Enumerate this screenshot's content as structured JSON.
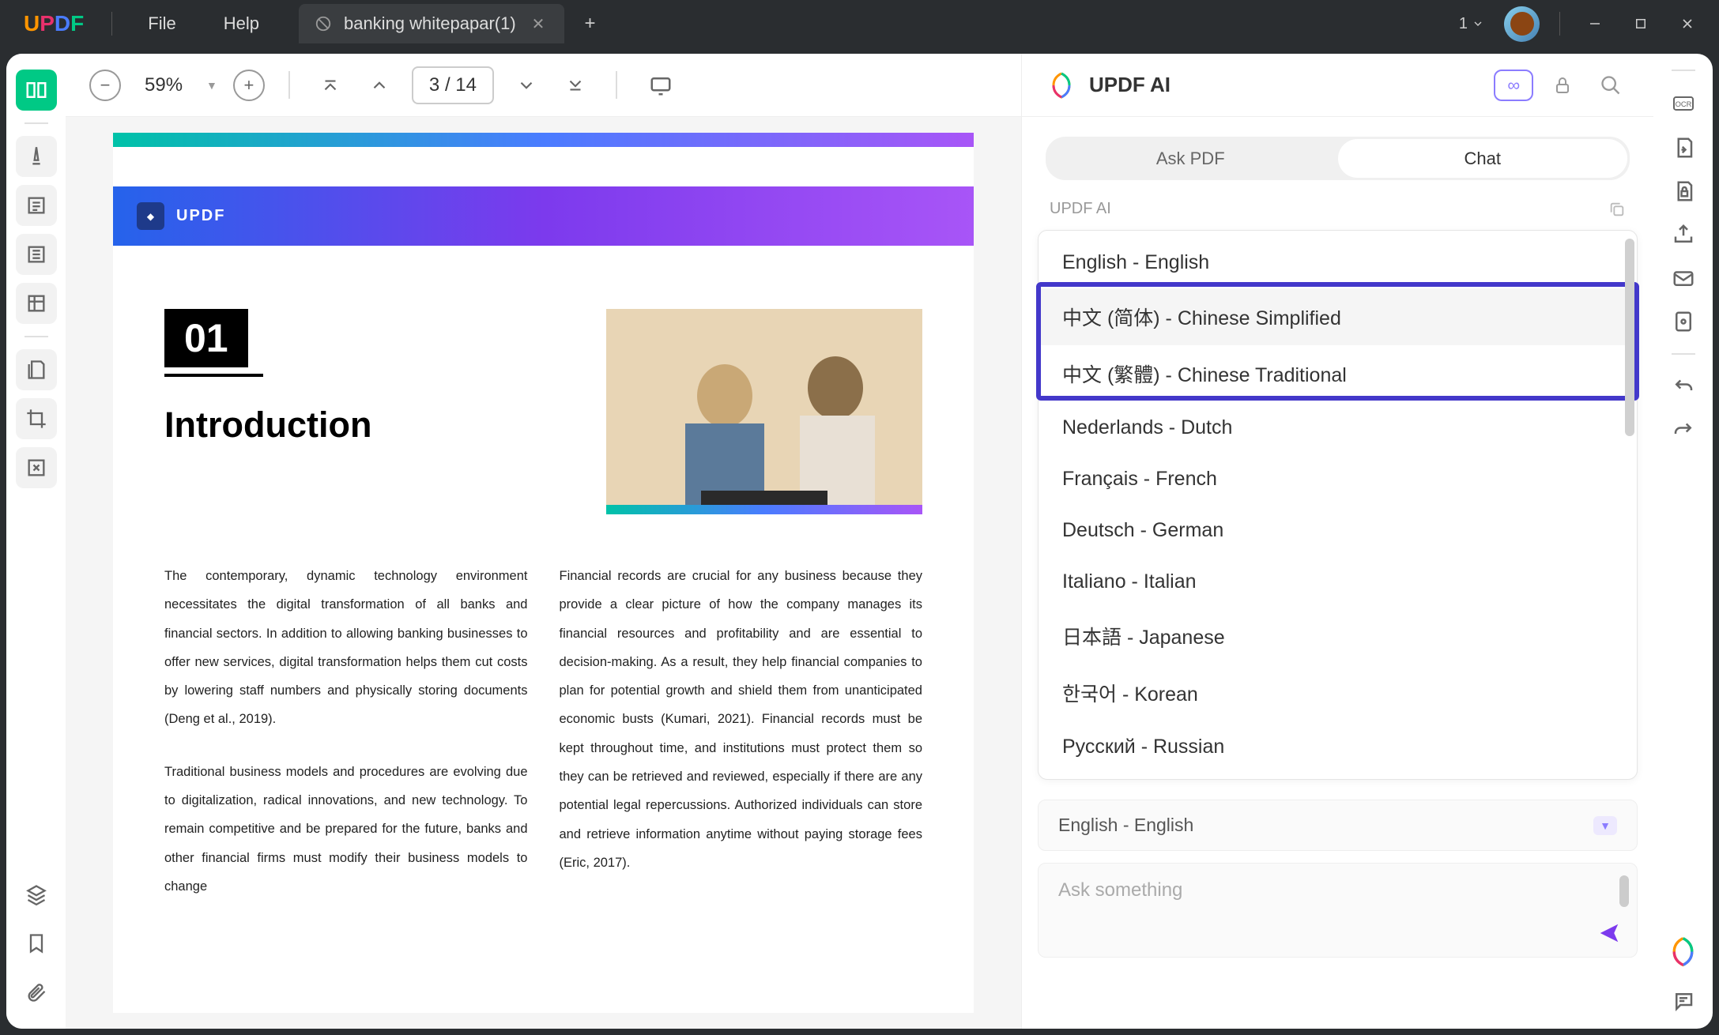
{
  "titlebar": {
    "logo": {
      "u": "U",
      "p": "P",
      "d": "D",
      "f": "F"
    },
    "menu": {
      "file": "File",
      "help": "Help"
    },
    "tab": {
      "title": "banking whitepapar(1)"
    },
    "window_count": "1"
  },
  "toolbar": {
    "zoom": "59%",
    "page_current": "3",
    "page_sep": "/",
    "page_total": "14"
  },
  "document": {
    "header_brand": "UPDF",
    "section_num": "01",
    "section_title": "Introduction",
    "col1_p1": "The contemporary, dynamic technology environment necessitates the digital transformation of all banks and financial sectors. In addition to allowing banking businesses to offer new services, digital transformation helps them cut costs by lowering staff numbers and physically storing documents (Deng et al., 2019).",
    "col1_p2": "Traditional business models and procedures are evolving due to digitalization, radical innovations, and new technology. To remain competitive and be prepared for the future, banks and other financial firms must modify their business models to change",
    "col2_p1": "Financial records are crucial for any business because they provide a clear picture of how the company manages its financial resources and profitability and are essential to decision-making. As a result, they help financial companies to plan for potential growth and shield them from unanticipated economic busts (Kumari, 2021). Financial records must be kept throughout time, and institutions must protect them so they can be retrieved and reviewed, especially if there are any potential legal repercussions. Authorized individuals can store and retrieve information anytime without paying storage fees (Eric, 2017)."
  },
  "ai": {
    "title": "UPDF AI",
    "tabs": {
      "ask": "Ask PDF",
      "chat": "Chat"
    },
    "label": "UPDF AI",
    "languages": [
      "English - English",
      "中文 (简体) - Chinese Simplified",
      "中文 (繁體) - Chinese Traditional",
      "Nederlands - Dutch",
      "Français - French",
      "Deutsch - German",
      "Italiano - Italian",
      "日本語 - Japanese",
      "한국어 - Korean",
      "Русский - Russian"
    ],
    "selected_language": "English - English",
    "ask_placeholder": "Ask something"
  }
}
